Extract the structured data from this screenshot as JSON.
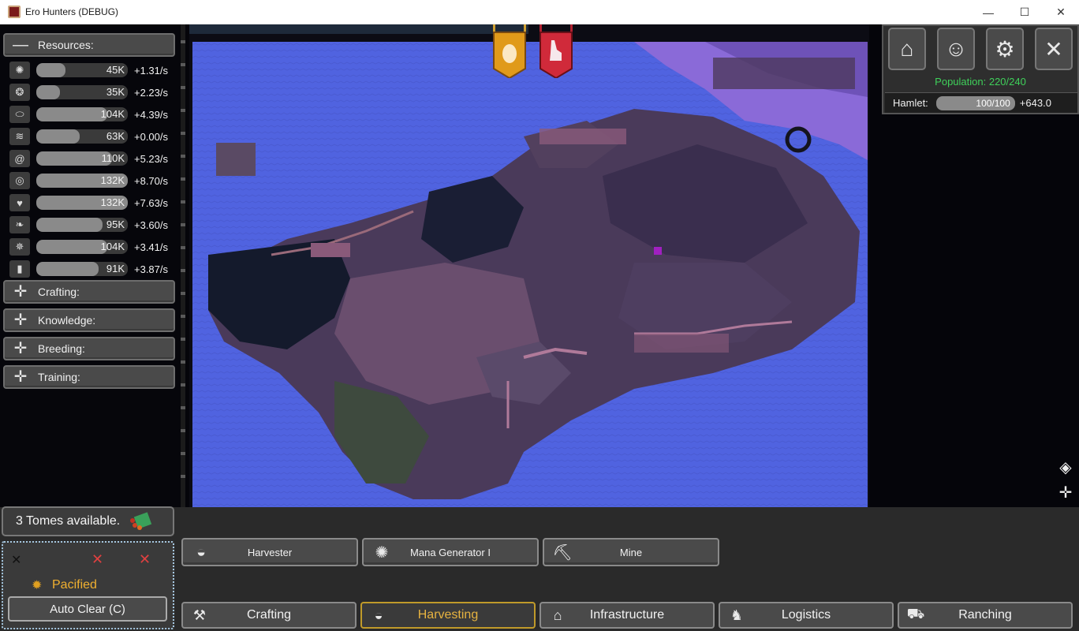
{
  "window": {
    "title": "Ero Hunters (DEBUG)",
    "minimize": "—",
    "maximize": "☐",
    "close": "✕"
  },
  "sidebar": {
    "resources_label": "Resources:",
    "resources": [
      {
        "icon": "mana-icon",
        "glyph": "✺",
        "value": "45K",
        "rate": "+1.31/s",
        "fill": 0.32
      },
      {
        "icon": "meat-icon",
        "glyph": "❂",
        "value": "35K",
        "rate": "+2.23/s",
        "fill": 0.26
      },
      {
        "icon": "bread-icon",
        "glyph": "⬭",
        "value": "104K",
        "rate": "+4.39/s",
        "fill": 0.78
      },
      {
        "icon": "wood-icon",
        "glyph": "≋",
        "value": "63K",
        "rate": "+0.00/s",
        "fill": 0.47
      },
      {
        "icon": "swirl-icon",
        "glyph": "@",
        "value": "110K",
        "rate": "+5.23/s",
        "fill": 0.83
      },
      {
        "icon": "fiber-icon",
        "glyph": "◎",
        "value": "132K",
        "rate": "+8.70/s",
        "fill": 1.0
      },
      {
        "icon": "heart-icon",
        "glyph": "♥",
        "value": "132K",
        "rate": "+7.63/s",
        "fill": 1.0
      },
      {
        "icon": "feather-icon",
        "glyph": "❧",
        "value": "95K",
        "rate": "+3.60/s",
        "fill": 0.72
      },
      {
        "icon": "seed-icon",
        "glyph": "✵",
        "value": "104K",
        "rate": "+3.41/s",
        "fill": 0.78
      },
      {
        "icon": "milk-icon",
        "glyph": "▮",
        "value": "91K",
        "rate": "+3.87/s",
        "fill": 0.68
      }
    ],
    "sections": [
      {
        "label": "Crafting:"
      },
      {
        "label": "Knowledge:"
      },
      {
        "label": "Breeding:"
      },
      {
        "label": "Training:"
      }
    ]
  },
  "top_right": {
    "population": "Population: 220/240",
    "hamlet_label": "Hamlet:",
    "hamlet_value": "100/100",
    "hamlet_rate": "+643.0"
  },
  "tomes": {
    "label": "3 Tomes available."
  },
  "status": {
    "pacified": "Pacified",
    "auto_clear": "Auto Clear (C)"
  },
  "build_options": [
    {
      "label": "Harvester",
      "icon": "basket-icon",
      "glyph": "◒"
    },
    {
      "label": "Mana Generator I",
      "icon": "mana-icon",
      "glyph": "✺"
    },
    {
      "label": "Mine",
      "icon": "pickaxe-icon",
      "glyph": "⛏"
    }
  ],
  "tabs": [
    {
      "label": "Crafting",
      "icon": "hammer-icon",
      "glyph": "⚒"
    },
    {
      "label": "Harvesting",
      "icon": "basket-icon",
      "glyph": "◒"
    },
    {
      "label": "Infrastructure",
      "icon": "gate-icon",
      "glyph": "⌂"
    },
    {
      "label": "Logistics",
      "icon": "boot-icon",
      "glyph": "♞"
    },
    {
      "label": "Ranching",
      "icon": "cart-icon",
      "glyph": "⛟"
    }
  ],
  "colors": {
    "water": "#5063e0",
    "population": "#3fd15a",
    "active_tab": "#e7b340"
  }
}
